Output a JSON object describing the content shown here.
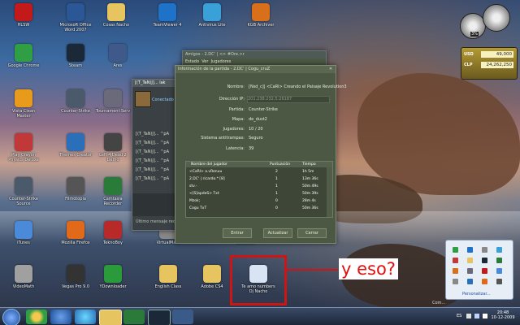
{
  "desktop_icons": [
    {
      "label": "HLSW",
      "icon": "hlsw-icon",
      "color": "#c21a1a"
    },
    {
      "label": "Microsoft Office Word 2007",
      "icon": "word-icon",
      "color": "#2b5797"
    },
    {
      "label": "Cosas Nacho",
      "icon": "folder-icon",
      "color": "#e6c460"
    },
    {
      "label": "TeamViewer 4",
      "icon": "teamviewer-icon",
      "color": "#1e73c8"
    },
    {
      "label": "Antivirus Lite",
      "icon": "antivirus-icon",
      "color": "#3aa0d8"
    },
    {
      "label": "KGB Archiver",
      "icon": "kgb-icon",
      "color": "#d86f1a"
    },
    {
      "label": "Google Chrome",
      "icon": "chrome-icon",
      "color": "#2f9e44"
    },
    {
      "label": "Steam",
      "icon": "steam-icon",
      "color": "#1b2838"
    },
    {
      "label": "Ares",
      "icon": "ares-icon",
      "color": "#3f5a8a"
    },
    {
      "label": "Vista Clean Master",
      "icon": "clean-icon",
      "color": "#e89a1c"
    },
    {
      "label": "Counter-Strike",
      "icon": "counterstrike-icon",
      "color": "#4a5a6a"
    },
    {
      "label": "Tournament Serv",
      "icon": "tournament-icon",
      "color": "#6a6a7a"
    },
    {
      "label": "Play Crayon Physics Deluxe",
      "icon": "crayon-icon",
      "color": "#c03838"
    },
    {
      "label": "Themes Creator",
      "icon": "themes-icon",
      "color": "#2a6fb8"
    },
    {
      "label": "Left 4 Dead 2 Demo",
      "icon": "l4d-icon",
      "color": "#444444"
    },
    {
      "label": "Counter-Strike Source",
      "icon": "css-icon",
      "color": "#4a5a6a"
    },
    {
      "label": "Filmotopia",
      "icon": "film-icon",
      "color": "#555555"
    },
    {
      "label": "Camtasia Recorder",
      "icon": "camtasia-icon",
      "color": "#2a7a3a"
    },
    {
      "label": "iTunes",
      "icon": "itunes-icon",
      "color": "#4a8ad8"
    },
    {
      "label": "Mozilla Firefox",
      "icon": "firefox-icon",
      "color": "#e06a1a"
    },
    {
      "label": "TeknoBoy",
      "icon": "tekno-icon",
      "color": "#b82a2a"
    },
    {
      "label": "VirtualMath",
      "icon": "vmath-icon",
      "color": "#888888"
    },
    {
      "label": "Evolution",
      "icon": "evo-icon",
      "color": "#3a5a8a"
    },
    {
      "label": "VideoMath",
      "icon": "vmath2-icon",
      "color": "#a0a0a0"
    },
    {
      "label": "Vegas Pro 9.0",
      "icon": "vegas-icon",
      "color": "#333333"
    },
    {
      "label": "YDownloader",
      "icon": "ydown-icon",
      "color": "#2a9a3a"
    },
    {
      "label": "English Class",
      "icon": "folder-icon",
      "color": "#e6c460"
    },
    {
      "label": "Adobe CS4",
      "icon": "folder-icon",
      "color": "#e6c460"
    },
    {
      "label": "Te amo numbers Dj Nacho",
      "icon": "audio-file-icon",
      "color": "#d8e4f4"
    }
  ],
  "steam_friends": {
    "title": "Amigos - 2.DC' | <> #Ore.>r",
    "menu": [
      "Estado",
      "Ver",
      "Jugadores"
    ],
    "chat_header": "[(T_TaN)J]... lak",
    "chat_status": "Conectado",
    "chat_lines": [
      "[(T_TaN)J]... ^pA",
      "[(T_TaN)J]... ^pA",
      "[(T_TaN)J]... ^pA",
      "[(T_TaN)J]... ^pA",
      "[(T_TaN)J]... ^pA",
      "[(T_TaN)J]... ^pA"
    ],
    "last_message": "Último mensaje rec"
  },
  "info_dialog": {
    "title": "Información de la partida - 2.DC' | Cogu_cruZ",
    "fields": [
      {
        "k": "Nombre:",
        "v": "[Nsd_c]| <CaRl> Creando el Paisaje Revolution3"
      },
      {
        "k": "Dirección IP:",
        "v": "201.238.232.5:26187"
      },
      {
        "k": "Partida:",
        "v": "Counter-Strike"
      },
      {
        "k": "Mapa:",
        "v": "de_dust2"
      },
      {
        "k": "Jugadores:",
        "v": "10 / 20"
      },
      {
        "k": "Sistema antitrampas:",
        "v": "Seguro"
      },
      {
        "k": "Latencia:",
        "v": "39"
      }
    ],
    "player_columns": [
      "Nombre del jugador",
      "Puntuación",
      "Tiempo"
    ],
    "players": [
      {
        "name": "<CaRl> a.vRenuu",
        "score": "2",
        "time": "1h 5m"
      },
      {
        "name": "2.DC' | ricardo.* [8]",
        "score": "1",
        "time": "13m 36s"
      },
      {
        "name": "stv.-",
        "score": "1",
        "time": "50m 49s"
      },
      {
        "name": "<[S]apdeS> Txt",
        "score": "1",
        "time": "50m 39s"
      },
      {
        "name": "Mzok;",
        "score": "0",
        "time": "28m 4s"
      },
      {
        "name": "Cogu TxT",
        "score": "0",
        "time": "50m 36s"
      }
    ],
    "buttons": [
      "Entrar",
      "Actualizar",
      "Cerrar"
    ]
  },
  "gadgets": {
    "cpu_percent": "3%",
    "usd_label": "USD",
    "usd_value": "49,000",
    "clp_label": "CLP",
    "clp_value": "24,262,250"
  },
  "tray": {
    "customize_label": "Personalizar...",
    "language": "ES",
    "time": "20:48",
    "date": "10-12-2009"
  },
  "annotation": {
    "text": "y eso?",
    "color": "#e01010"
  },
  "watermark": "Com..."
}
